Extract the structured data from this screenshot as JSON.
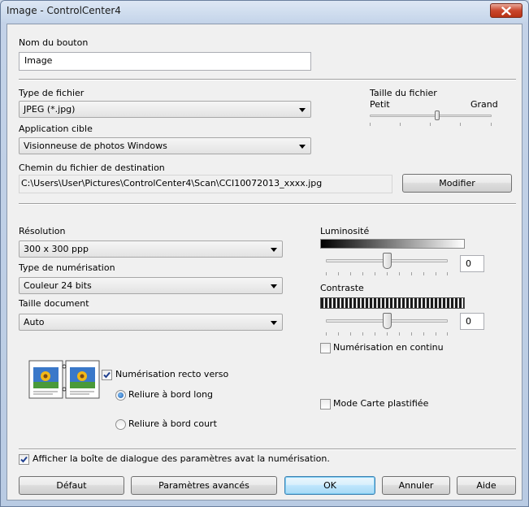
{
  "window": {
    "title": "Image - ControlCenter4"
  },
  "button_name": {
    "label": "Nom du bouton",
    "value": "Image"
  },
  "file_type": {
    "label": "Type de fichier",
    "value": "JPEG (*.jpg)"
  },
  "file_size": {
    "label": "Taille du fichier",
    "min_label": "Petit",
    "max_label": "Grand",
    "position": 0.55
  },
  "target_app": {
    "label": "Application cible",
    "value": "Visionneuse de photos Windows"
  },
  "destination": {
    "label": "Chemin du fichier de destination",
    "value": "C:\\Users\\User\\Pictures\\ControlCenter4\\Scan\\CCI10072013_xxxx.jpg",
    "change_label": "Modifier"
  },
  "resolution": {
    "label": "Résolution",
    "value": "300 x 300 ppp"
  },
  "scan_type": {
    "label": "Type de numérisation",
    "value": "Couleur 24 bits"
  },
  "doc_size": {
    "label": "Taille document",
    "value": "Auto"
  },
  "brightness": {
    "label": "Luminosité",
    "value": "0",
    "position": 0.5
  },
  "contrast": {
    "label": "Contraste",
    "value": "0",
    "position": 0.5
  },
  "continuous_scan": {
    "label": "Numérisation en continu",
    "checked": false
  },
  "duplex": {
    "label": "Numérisation recto verso",
    "checked": true,
    "long_edge": "Reliure à bord long",
    "short_edge": "Reliure à bord court"
  },
  "plastic_card": {
    "label": "Mode Carte plastifiée",
    "checked": false
  },
  "show_settings": {
    "label": "Afficher la boîte de dialogue des paramètres avat la numérisation.",
    "checked": true
  },
  "footer": {
    "default_label": "Défaut",
    "advanced_label": "Paramètres avancés",
    "ok_label": "OK",
    "cancel_label": "Annuler",
    "help_label": "Aide"
  },
  "colors": {
    "accent": "#3c7fb1",
    "close": "#c9462c"
  }
}
